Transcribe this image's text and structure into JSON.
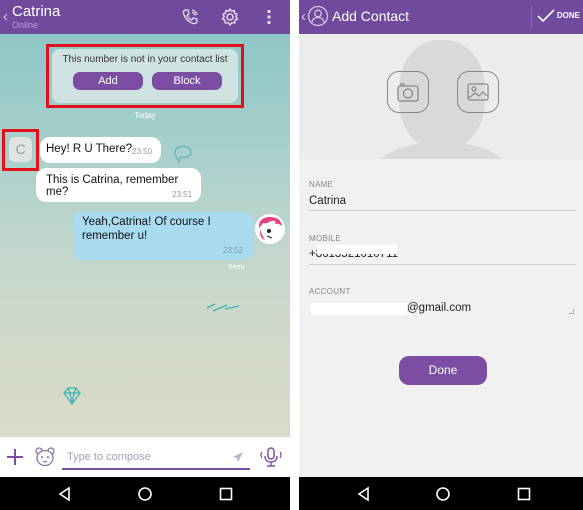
{
  "chat": {
    "title": "Catrina",
    "status": "Online",
    "notice": {
      "text": "This number is not in your contact list",
      "add_label": "Add",
      "block_label": "Block"
    },
    "date_divider": "Today",
    "avatar_initial": "C",
    "messages": [
      {
        "direction": "in",
        "text": "Hey! R U There?",
        "time": "23:50"
      },
      {
        "direction": "in",
        "text": "This is Catrina, remember me?",
        "time": "23:51"
      },
      {
        "direction": "out",
        "text_line1": "Yeah,Catrina! Of course I",
        "text_line2": "remember u!",
        "time": "23:52",
        "status": "Seen"
      }
    ],
    "composer": {
      "placeholder": "Type to compose"
    },
    "icons": {
      "back": "chevron-left-icon",
      "call": "phone-icon",
      "settings": "gear-icon",
      "more": "more-vertical-icon",
      "add": "plus-icon",
      "sticker": "bear-icon",
      "send": "send-icon",
      "voice": "microphone-icon"
    }
  },
  "add_contact": {
    "title": "Add Contact",
    "done_top_label": "DONE",
    "fields": [
      {
        "label": "NAME",
        "value": "Catrina"
      },
      {
        "label": "MOBILE",
        "value": "+8613521010711"
      },
      {
        "label": "ACCOUNT",
        "value": "@gmail.com"
      }
    ],
    "done_button": "Done"
  },
  "colors": {
    "brand_purple": "#724a9d",
    "button_purple": "#7b4ea3",
    "highlight_red": "#e3101b",
    "outgoing_bubble": "#a8daf0"
  },
  "system_nav": {
    "back": "back-icon",
    "home": "home-icon",
    "recents": "recents-icon"
  }
}
